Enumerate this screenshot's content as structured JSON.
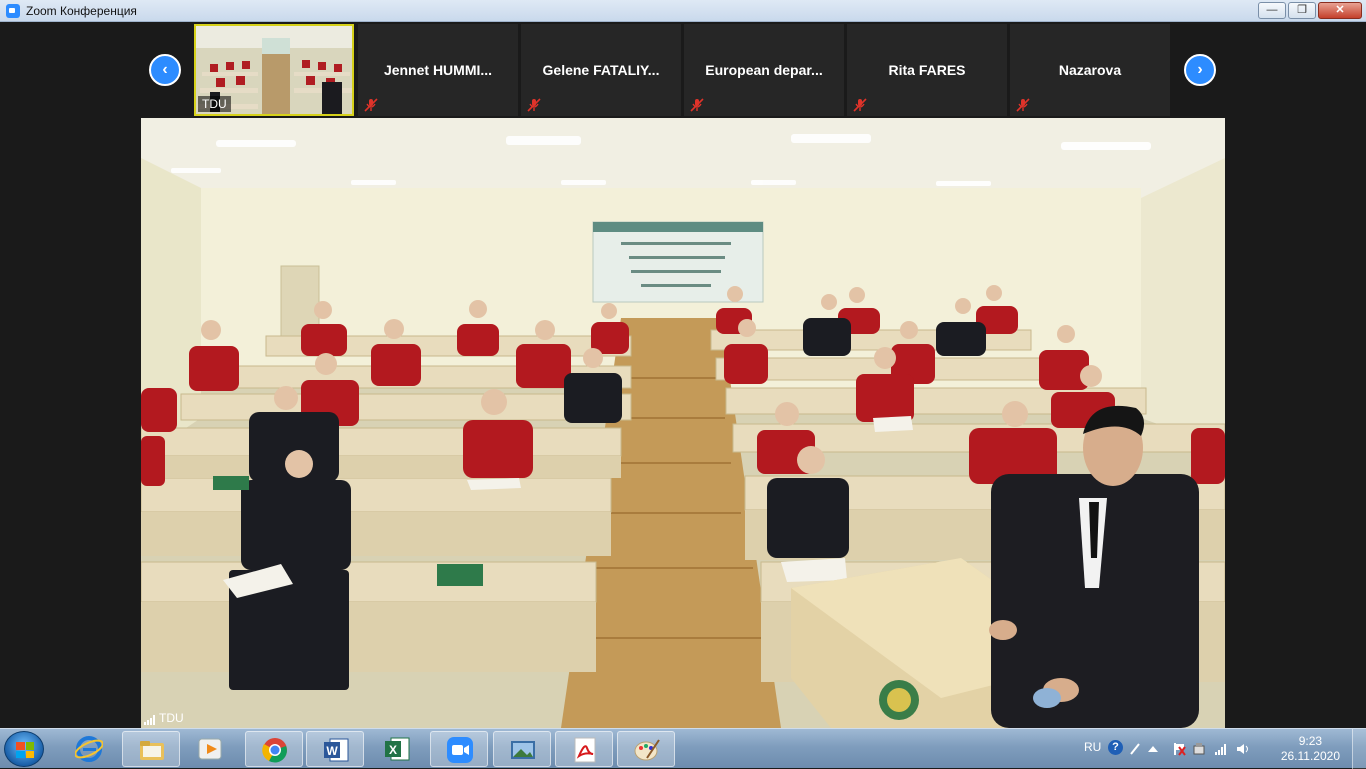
{
  "window": {
    "title": "Zoom Конференция",
    "minimize_label": "—",
    "maximize_label": "❐",
    "close_label": "✕"
  },
  "gallery": {
    "prev_label": "‹",
    "next_label": "›",
    "video_tile_label": "TDU",
    "participants": [
      {
        "name": "Jennet HUMMI...",
        "muted": true
      },
      {
        "name": "Gelene FATALIY...",
        "muted": true
      },
      {
        "name": "European depar...",
        "muted": true
      },
      {
        "name": "Rita FARES",
        "muted": true
      },
      {
        "name": "Nazarova",
        "muted": true
      }
    ]
  },
  "main_video": {
    "speaker_name": "TDU"
  },
  "taskbar": {
    "apps": [
      "windows-explorer",
      "internet-explorer",
      "file-explorer",
      "media-player",
      "chrome",
      "word",
      "excel",
      "zoom",
      "photo-viewer",
      "acrobat-reader",
      "paint"
    ],
    "language": "RU",
    "help_label": "?",
    "time": "9:23",
    "date": "26.11.2020"
  }
}
